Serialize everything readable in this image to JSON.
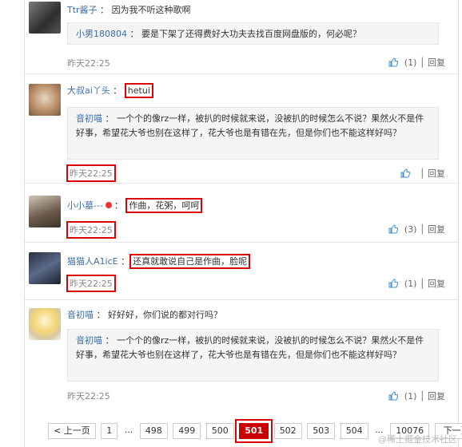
{
  "comments": [
    {
      "username": "Ttr酱子",
      "text": "因为我不听这种歌啊",
      "quote_user": "小男180804",
      "quote_text": "要是下架了还得费好大功夫去找百度网盘版的，何必呢？",
      "time": "昨天22:25",
      "likes": "(1)",
      "reply": "回复"
    },
    {
      "username": "大叔ai丫头",
      "text": "hetui",
      "quote_user": "音初喵",
      "quote_text": "一个个的像rz一样，被扒的时候就来说，没被扒的时候怎么不说？果然火不是件好事，希望花大爷也别在这样了，花大爷也是有错在先，但是你们也不能这样好吗？",
      "time": "昨天22:25",
      "likes": "",
      "reply": "回复"
    },
    {
      "username": "小小墓---",
      "text": "作曲，花粥，呵呵",
      "time": "昨天22:25",
      "likes": "(3)",
      "reply": "回复"
    },
    {
      "username": "猫猫人A1icE",
      "text": "还真就敢说自己是作曲，脸呢",
      "time": "昨天22:25",
      "likes": "(1)",
      "reply": "回复"
    },
    {
      "username": "音初喵",
      "text": "好好好，你们说的都对行吗？",
      "quote_user": "音初喵",
      "quote_text": "一个个的像rz一样，被扒的时候就来说，没被扒的时候怎么不说？果然火不是件好事，希望花大爷也别在这样了，花大爷也是有错在先，但是你们也不能这样好吗？",
      "time": "昨天22:25",
      "likes": "(1)",
      "reply": "回复"
    }
  ],
  "pager": {
    "prev": "< 上一页",
    "pages": [
      "1",
      "...",
      "498",
      "499",
      "500",
      "501",
      "502",
      "503",
      "504",
      "...",
      "10076"
    ],
    "current": "501",
    "next": "下一页"
  },
  "watermark": "@稀土掘金技术社区",
  "colors": {
    "username": "#3c6ea8",
    "active_page": "#cc0000",
    "annotation_box": "#dd0000"
  }
}
